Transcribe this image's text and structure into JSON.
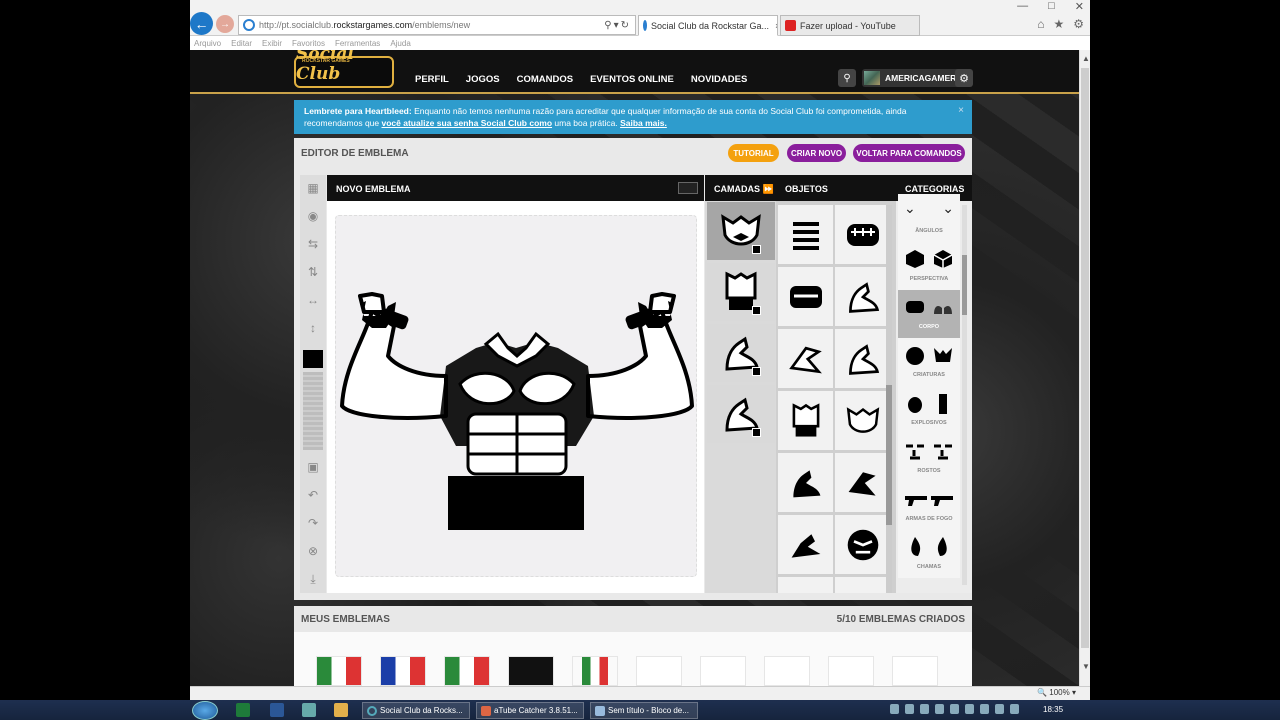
{
  "browser": {
    "back_icon": "arrow-left-icon",
    "url_prefix": "http://pt.socialclub.",
    "url_host": "rockstargames.com",
    "url_path": "/emblems/new",
    "tabs": [
      {
        "label": "Social Club da Rockstar Ga...",
        "close": "×"
      },
      {
        "label": "Fazer upload - YouTube"
      }
    ],
    "menu": [
      "Arquivo",
      "Editar",
      "Exibir",
      "Favoritos",
      "Ferramentas",
      "Ajuda"
    ],
    "zoom": "100%"
  },
  "site": {
    "logo_top": "ROCKSTAR GAMES",
    "logo": "Social Club",
    "nav": [
      "PERFIL",
      "JOGOS",
      "COMANDOS",
      "EVENTOS ONLINE",
      "NOVIDADES"
    ],
    "username": "AMERICAGAMER"
  },
  "alert": {
    "title": "Lembrete para Heartbleed:",
    "text1": " Enquanto não temos nenhuma razão para acreditar que qualquer informação de sua conta do Social Club foi comprometida, ainda recomendamos que ",
    "link": "você atualize sua senha Social Club como",
    "text2": " uma boa prática. ",
    "more": "Saiba mais.",
    "close": "×"
  },
  "editor": {
    "title": "EDITOR DE EMBLEMA",
    "tutorial": "TUTORIAL",
    "new": "CRIAR NOVO",
    "back": "VOLTAR PARA COMANDOS",
    "canvas_title": "NOVO EMBLEMA",
    "layers_title": "CAMADAS",
    "objects_title": "OBJETOS",
    "categories_title": "CATEGORIAS",
    "categories": [
      "ÂNGULOS",
      "PERSPECTIVA",
      "CORPO",
      "CRIATURAS",
      "EXPLOSIVOS",
      "ROSTOS",
      "ARMAS DE FOGO",
      "CHAMAS"
    ],
    "selected_category": "CORPO"
  },
  "my_emblems": {
    "title": "MEUS EMBLEMAS",
    "count": "5/10 EMBLEMAS CRIADOS"
  },
  "taskbar": {
    "tasks": [
      "Social Club da Rocks...",
      "aTube Catcher 3.8.51...",
      "Sem título - Bloco de..."
    ],
    "clock": "18:35"
  }
}
